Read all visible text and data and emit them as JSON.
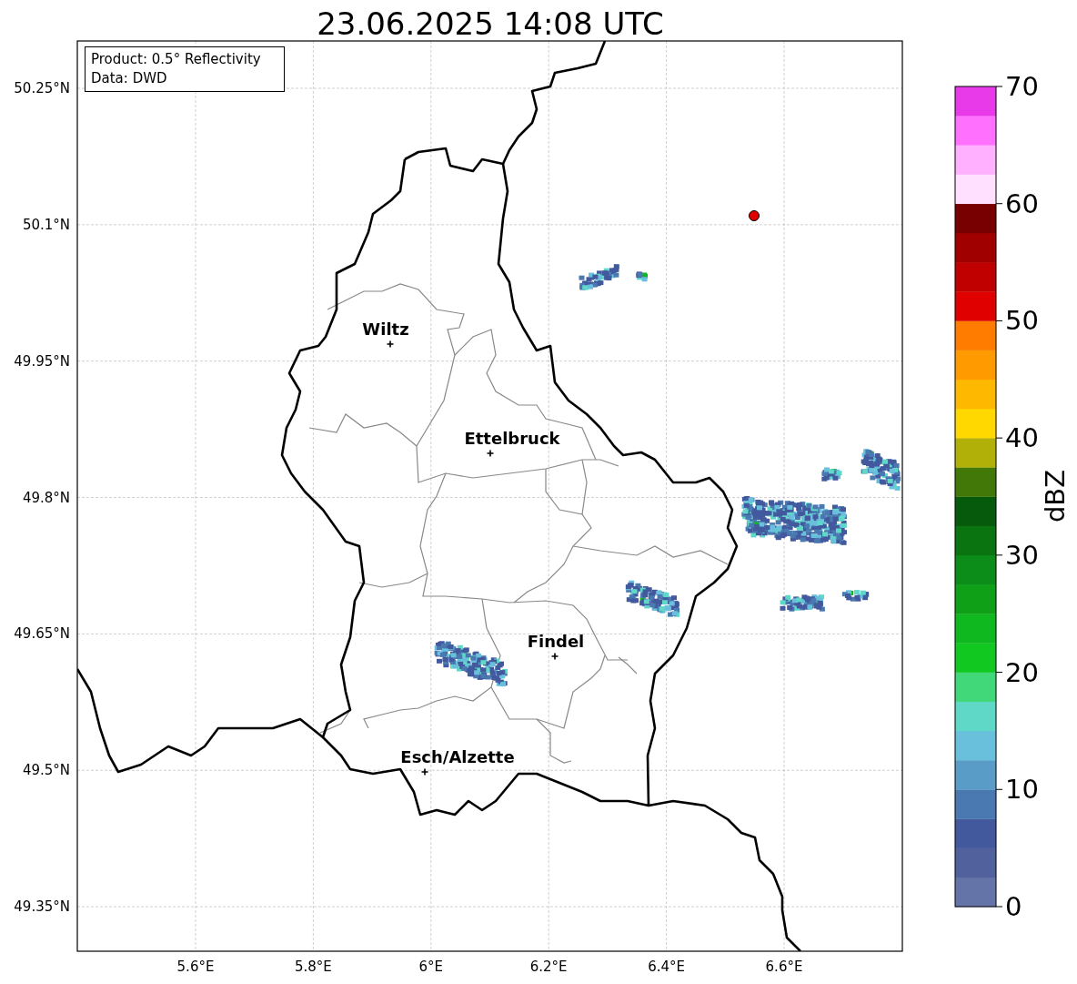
{
  "title": "23.06.2025 14:08 UTC",
  "info_box": {
    "lines": [
      "Product: 0.5° Reflectivity",
      "Data: DWD"
    ]
  },
  "map": {
    "lat_labels": [
      "50.25°N",
      "50.1°N",
      "49.95°N",
      "49.8°N",
      "49.65°N",
      "49.5°N",
      "49.35°N"
    ],
    "lon_labels": [
      "5.6°E",
      "5.8°E",
      "6°E",
      "6.2°E",
      "6.4°E",
      "6.6°E"
    ],
    "cities": [
      {
        "name": "Wiltz"
      },
      {
        "name": "Ettelbruck"
      },
      {
        "name": "Findel"
      },
      {
        "name": "Esch/Alzette"
      }
    ]
  },
  "colorbar": {
    "label": "dBZ",
    "ticks": [
      "70",
      "60",
      "50",
      "40",
      "30",
      "20",
      "10",
      "0"
    ],
    "bins": [
      {
        "color": "#6474a8"
      },
      {
        "color": "#50619e"
      },
      {
        "color": "#42599e"
      },
      {
        "color": "#4a78b0"
      },
      {
        "color": "#5a9cc8"
      },
      {
        "color": "#68c0dc"
      },
      {
        "color": "#60d8c8"
      },
      {
        "color": "#40d878"
      },
      {
        "color": "#10c820"
      },
      {
        "color": "#10b820"
      },
      {
        "color": "#10a018"
      },
      {
        "color": "#0c8c18"
      },
      {
        "color": "#0a7410"
      },
      {
        "color": "#065a0c"
      },
      {
        "color": "#427808"
      },
      {
        "color": "#b0b008"
      },
      {
        "color": "#ffd800"
      },
      {
        "color": "#ffb800"
      },
      {
        "color": "#ff9a00"
      },
      {
        "color": "#ff7c00"
      },
      {
        "color": "#e00000"
      },
      {
        "color": "#c00000"
      },
      {
        "color": "#a00000"
      },
      {
        "color": "#780000"
      },
      {
        "color": "#ffe0ff"
      },
      {
        "color": "#ffb0ff"
      },
      {
        "color": "#ff70ff"
      },
      {
        "color": "#e83ae8"
      }
    ]
  }
}
